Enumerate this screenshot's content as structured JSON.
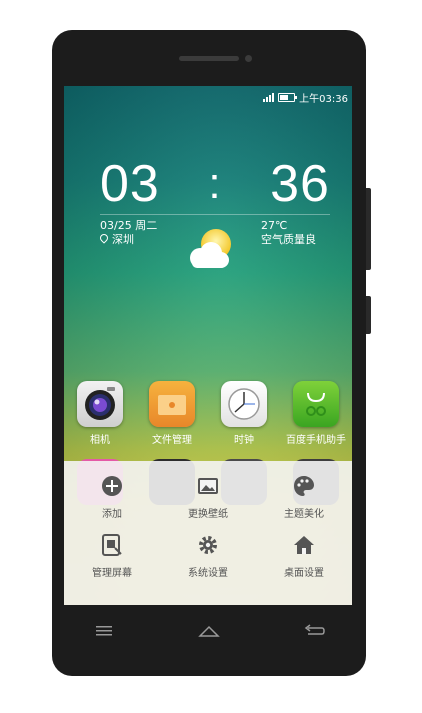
{
  "status_bar": {
    "time": "上午03:36"
  },
  "clock_widget": {
    "hour": "03",
    "separator": ":",
    "minute": "36",
    "date": "03/25",
    "weekday": "周二",
    "city": "深圳",
    "temperature": "27℃",
    "air_quality": "空气质量良"
  },
  "apps": [
    {
      "label": "相机",
      "icon": "camera-icon"
    },
    {
      "label": "文件管理",
      "icon": "folder-icon"
    },
    {
      "label": "时钟",
      "icon": "clock-icon"
    },
    {
      "label": "百度手机助手",
      "icon": "shopping-bag-icon"
    }
  ],
  "menu": [
    {
      "label": "添加",
      "icon": "plus-icon"
    },
    {
      "label": "更换壁纸",
      "icon": "image-icon"
    },
    {
      "label": "主题美化",
      "icon": "palette-icon"
    },
    {
      "label": "管理屏幕",
      "icon": "screen-manage-icon"
    },
    {
      "label": "系统设置",
      "icon": "gear-icon"
    },
    {
      "label": "桌面设置",
      "icon": "home-icon"
    }
  ],
  "colors": {
    "menu_icon": "#555555",
    "sheet_background": "#f4f4f4"
  }
}
